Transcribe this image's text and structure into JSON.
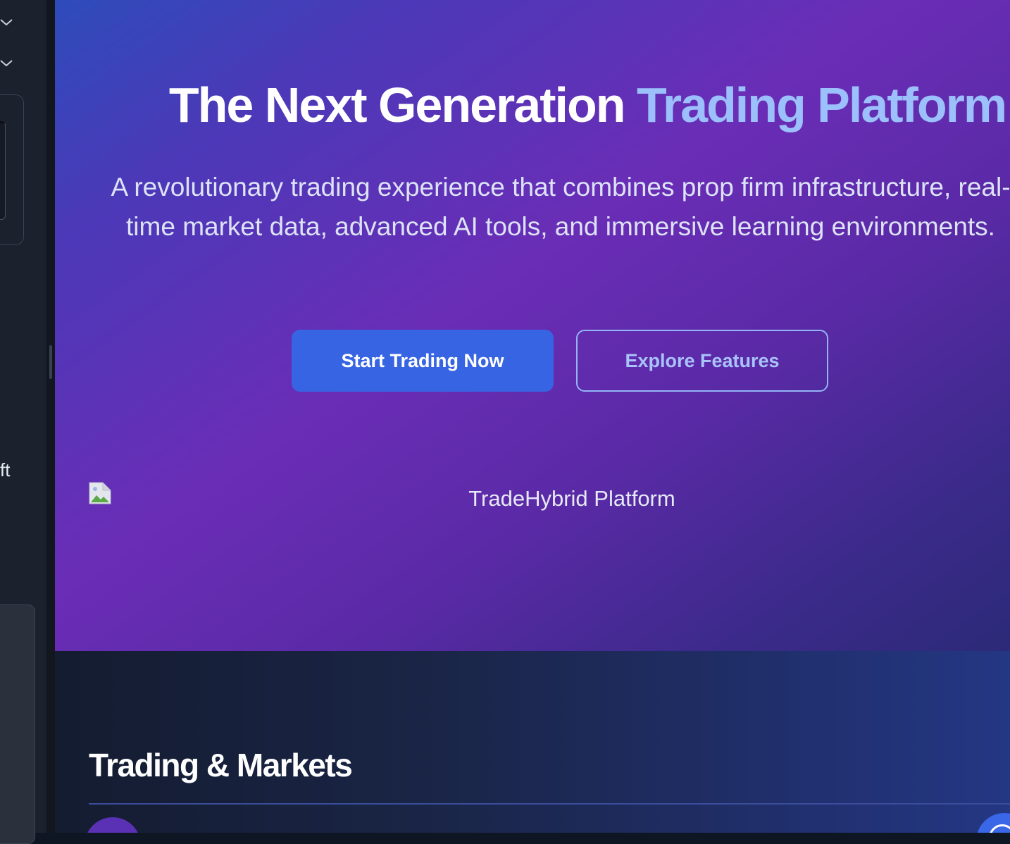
{
  "sidebar": {
    "partial_label": "ft"
  },
  "hero": {
    "title_main": "The Next Generation ",
    "title_accent": "Trading Platform",
    "subtitle": "A revolutionary trading experience that combines prop firm infrastructure, real-time market data, advanced AI tools, and immersive learning environments.",
    "primary_button": "Start Trading Now",
    "secondary_button": "Explore Features",
    "image_alt": "TradeHybrid Platform"
  },
  "markets": {
    "title": "Trading & Markets"
  },
  "colors": {
    "accent_text": "#9cc0fb",
    "primary_button": "#3764e2",
    "hero_gradient_start": "#2e4cbb",
    "hero_gradient_mid": "#6a2db6",
    "hero_gradient_end": "#2c2a78",
    "section_bg": "#1a2547"
  },
  "icons": {
    "sidebar_chevron_1": "chevron-down-icon",
    "sidebar_chevron_2": "chevron-down-icon",
    "broken_image": "broken-image-icon"
  }
}
